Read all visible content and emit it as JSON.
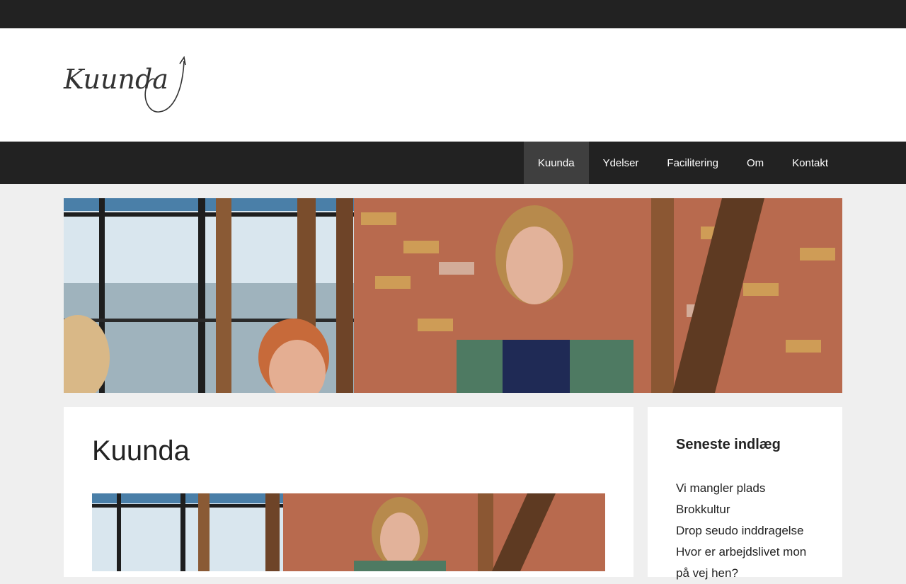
{
  "brand": {
    "logo_text": "Kuunda"
  },
  "nav": {
    "items": [
      {
        "label": "Kuunda",
        "active": true
      },
      {
        "label": "Ydelser",
        "active": false
      },
      {
        "label": "Facilitering",
        "active": false
      },
      {
        "label": "Om",
        "active": false
      },
      {
        "label": "Kontakt",
        "active": false
      }
    ]
  },
  "page": {
    "title": "Kuunda"
  },
  "sidebar": {
    "widget_title": "Seneste indlæg",
    "posts": [
      "Vi mangler plads",
      "Brokkultur",
      "Drop seudo inddragelse",
      "Hvor er arbejdslivet mon på vej hen?"
    ]
  },
  "colors": {
    "dark_bar": "#222222",
    "nav_active": "#3f3f3f",
    "page_bg": "#efefef",
    "card_bg": "#ffffff"
  }
}
